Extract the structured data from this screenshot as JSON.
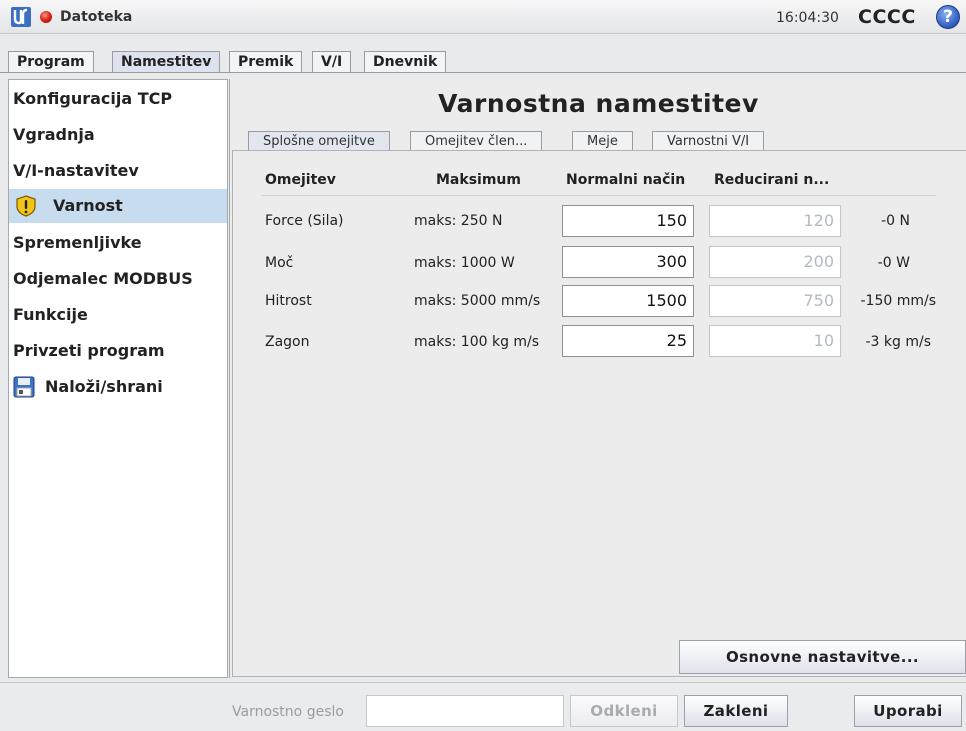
{
  "header": {
    "file_name": "Datoteka",
    "time": "16:04:30",
    "robot_name": "CCCC",
    "help_glyph": "?",
    "status_color": "#e0281c"
  },
  "main_tabs": [
    {
      "label": "Program",
      "active": false
    },
    {
      "label": "Namestitev",
      "active": true
    },
    {
      "label": "Premik",
      "active": false
    },
    {
      "label": "V/I",
      "active": false
    },
    {
      "label": "Dnevnik",
      "active": false
    }
  ],
  "sidebar": {
    "items": [
      {
        "label": "Konfiguracija TCP",
        "icon": null
      },
      {
        "label": "Vgradnja",
        "icon": null
      },
      {
        "label": "V/I-nastavitev",
        "icon": null
      },
      {
        "label": "Varnost",
        "icon": "warning-shield-icon",
        "selected": true
      },
      {
        "label": "Spremenljivke",
        "icon": null
      },
      {
        "label": "Odjemalec MODBUS",
        "icon": null
      },
      {
        "label": "Funkcije",
        "icon": null
      },
      {
        "label": "Privzeti program",
        "icon": null
      },
      {
        "label": "Naloži/shrani",
        "icon": "floppy-disk-icon"
      }
    ]
  },
  "panel": {
    "title": "Varnostna namestitev",
    "sub_tabs": [
      {
        "label": "Splošne omejitve",
        "active": true
      },
      {
        "label": "Omejitev člen...",
        "active": false
      },
      {
        "label": "Meje",
        "active": false
      },
      {
        "label": "Varnostni V/I",
        "active": false
      }
    ],
    "columns": [
      "Omejitev",
      "Maksimum",
      "Normalni način",
      "Reducirani n..."
    ],
    "rows": [
      {
        "name": "Force (Sila)",
        "max": "maks: 250 N",
        "normal": "150",
        "reduced": "120",
        "delta": "-0 N"
      },
      {
        "name": "Moč",
        "max": "maks: 1000 W",
        "normal": "300",
        "reduced": "200",
        "delta": "-0 W"
      },
      {
        "name": "Hitrost",
        "max": "maks: 5000 mm/s",
        "normal": "1500",
        "reduced": "750",
        "delta": "-150 mm/s"
      },
      {
        "name": "Zagon",
        "max": "maks: 100 kg m/s",
        "normal": "25",
        "reduced": "10",
        "delta": "-3 kg m/s"
      }
    ],
    "defaults_button": "Osnovne nastavitve..."
  },
  "footer": {
    "password_label": "Varnostno geslo",
    "password_value": "",
    "unlock_button": "Odkleni",
    "lock_button": "Zakleni",
    "apply_button": "Uporabi"
  }
}
